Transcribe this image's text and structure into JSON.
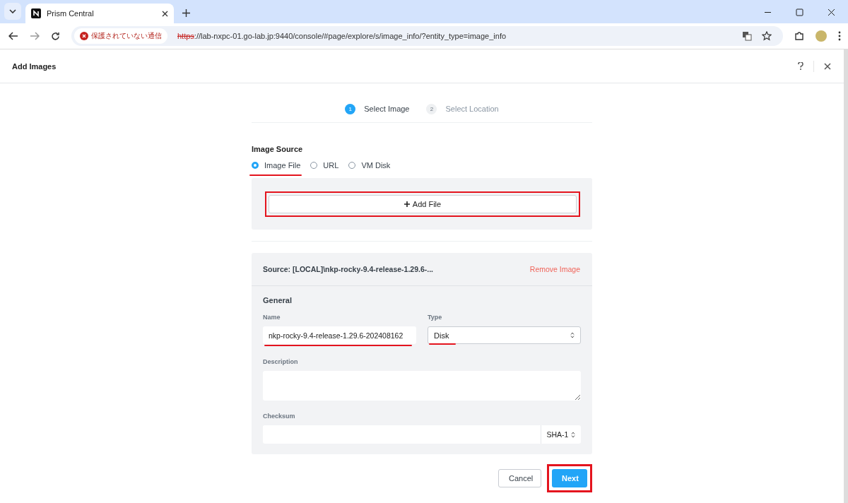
{
  "browser": {
    "tab_title": "Prism Central",
    "security_label": "保護されていない通信",
    "url_scheme": "https",
    "url_rest": "://lab-nxpc-01.go-lab.jp:9440/console/#page/explore/s/image_info/?entity_type=image_info"
  },
  "dialog": {
    "title": "Add Images",
    "steps": [
      {
        "number": "1",
        "label": "Select Image",
        "selected": true
      },
      {
        "number": "2",
        "label": "Select Location",
        "selected": false
      }
    ],
    "image_source": {
      "label": "Image Source",
      "options": [
        {
          "label": "Image File",
          "selected": true
        },
        {
          "label": "URL",
          "selected": false
        },
        {
          "label": "VM Disk",
          "selected": false
        }
      ]
    },
    "add_file_button": "Add File",
    "source_card": {
      "source": "Source: [LOCAL]\\nkp-rocky-9.4-release-1.29.6-...",
      "remove_link": "Remove Image",
      "section_title": "General",
      "name": {
        "label": "Name",
        "value": "nkp-rocky-9.4-release-1.29.6-202408162"
      },
      "type": {
        "label": "Type",
        "value": "Disk"
      },
      "description": {
        "label": "Description"
      },
      "checksum": {
        "label": "Checksum",
        "algorithm": "SHA-1"
      }
    },
    "buttons": [
      {
        "label": "Cancel",
        "kind": "secondary"
      },
      {
        "label": "Next",
        "kind": "primary"
      }
    ]
  }
}
